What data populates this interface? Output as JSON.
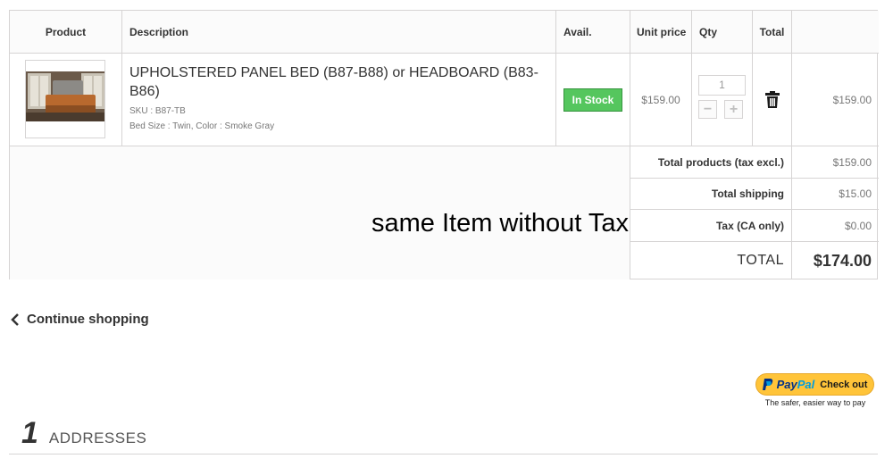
{
  "table": {
    "headers": {
      "product": "Product",
      "description": "Description",
      "avail": "Avail.",
      "unit_price": "Unit price",
      "qty": "Qty",
      "total": "Total"
    },
    "item": {
      "name": "UPHOLSTERED PANEL BED (B87-B88) or HEADBOARD (B83-B86)",
      "sku": "SKU : B87-TB",
      "attributes": "Bed Size : Twin, Color : Smoke Gray",
      "availability": "In Stock",
      "unit_price": "$159.00",
      "quantity": "1",
      "total": "$159.00",
      "delete_icon": "trash-icon"
    }
  },
  "summary": {
    "products_label": "Total products (tax excl.)",
    "products_value": "$159.00",
    "shipping_label": "Total shipping",
    "shipping_value": "$15.00",
    "tax_label": "Tax (CA only)",
    "tax_value": "$0.00",
    "total_label": "TOTAL",
    "total_value": "$174.00"
  },
  "annotation": "same Item without Tax",
  "continue_shopping": "Continue shopping",
  "paypal": {
    "pay": "Pay",
    "pal": "Pal",
    "checkout": "Check out",
    "tagline": "The safer, easier way to pay"
  },
  "step": {
    "number": "1",
    "label": "ADDRESSES"
  },
  "colors": {
    "in_stock": "#55c65e",
    "paypal_button": "#ffc439",
    "paypal_dark": "#003087",
    "paypal_light": "#009cde"
  }
}
